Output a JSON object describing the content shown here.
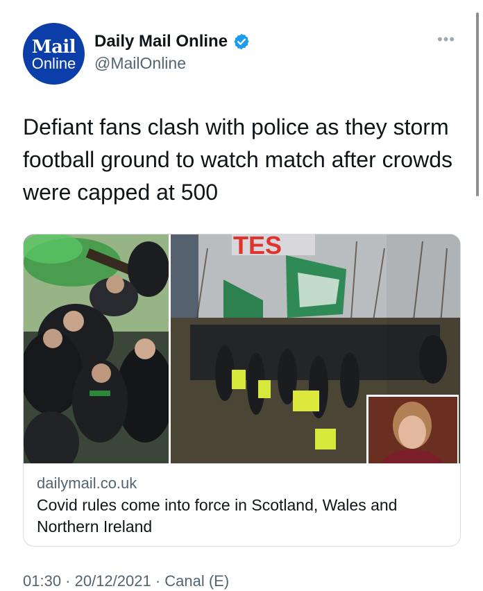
{
  "account": {
    "display_name": "Daily Mail Online",
    "handle": "@MailOnline",
    "avatar_text_top": "Mail",
    "avatar_text_bottom": "Online",
    "verified": true,
    "brand_color": "#0b3ea8",
    "verified_color": "#1d9bf0"
  },
  "tweet": {
    "text": "Defiant fans clash with police as they storm football ground to watch match after crowds were capped at 500",
    "more_icon": "more-horizontal-icon",
    "more_glyph": "•••"
  },
  "link_card": {
    "domain": "dailymail.co.uk",
    "title": "Covid rules come into force in Scotland, Wales and Northern Ireland",
    "image_description_icon": "news-photo",
    "image_overlay_text": "TES"
  },
  "footer": {
    "partial_text": "01:30 · 20/12/2021 · Canal (E)"
  }
}
